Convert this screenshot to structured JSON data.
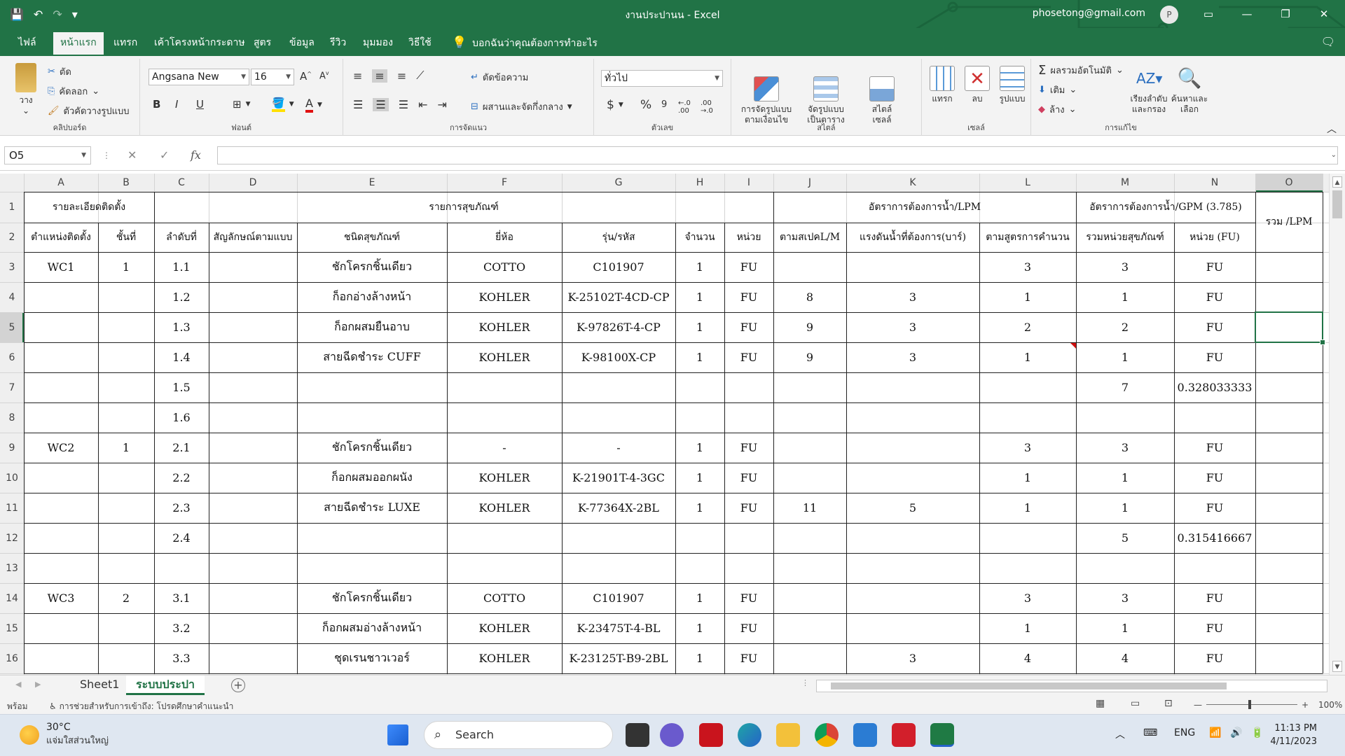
{
  "window": {
    "title": "งานประปานน  -  Excel",
    "account": "phosetong@gmail.com",
    "avatar_letter": "P"
  },
  "tabs": [
    {
      "label": "ไฟล์"
    },
    {
      "label": "หน้าแรก"
    },
    {
      "label": "แทรก"
    },
    {
      "label": "เค้าโครงหน้ากระดาษ"
    },
    {
      "label": "สูตร"
    },
    {
      "label": "ข้อมูล"
    },
    {
      "label": "รีวิว"
    },
    {
      "label": "มุมมอง"
    },
    {
      "label": "วิธีใช้"
    }
  ],
  "tell_me": "บอกฉันว่าคุณต้องการทำอะไร",
  "ribbon": {
    "clipboard": {
      "name": "คลิปบอร์ด",
      "paste": "วาง",
      "cut": "ตัด",
      "copy": "คัดลอก",
      "format_painter": "ตัวคัดวางรูปแบบ"
    },
    "font": {
      "name": "ฟอนต์",
      "family": "Angsana New",
      "size": "16",
      "bold": "B",
      "italic": "I",
      "underline": "U"
    },
    "alignment": {
      "name": "การจัดแนว",
      "wrap": "ตัดข้อความ",
      "merge": "ผสานและจัดกึ่งกลาง"
    },
    "number": {
      "name": "ตัวเลข",
      "format": "ทั่วไป",
      "currency": "$",
      "percent": "%"
    },
    "styles": {
      "name": "สไตล์",
      "conditional": "การจัดรูปแบบ\nตามเงื่อนไข",
      "as_table": "จัดรูปแบบ\nเป็นตาราง",
      "cell_styles": "สไตล์\nเซลล์"
    },
    "cells": {
      "name": "เซลล์",
      "insert": "แทรก",
      "delete": "ลบ",
      "format": "รูปแบบ"
    },
    "editing": {
      "name": "การแก้ไข",
      "autosum": "ผลรวมอัตโนมัติ",
      "fill": "เติม",
      "clear": "ล้าง",
      "sort": "เรียงลำดับ\nและกรอง",
      "find": "ค้นหาและ\nเลือก"
    }
  },
  "formula_bar": {
    "name_box": "O5",
    "fx": "fx",
    "value": ""
  },
  "grid": {
    "columns": [
      "A",
      "B",
      "C",
      "D",
      "E",
      "F",
      "G",
      "H",
      "I",
      "J",
      "K",
      "L",
      "M",
      "N",
      "O"
    ],
    "rows": [
      "1",
      "2",
      "3",
      "4",
      "5",
      "6",
      "7",
      "8",
      "9",
      "10",
      "11",
      "12",
      "13",
      "14",
      "15",
      "16"
    ],
    "headers_row1": {
      "install": "รายละเอียดติดตั้ง",
      "sanitary": "รายการสุขภัณฑ์",
      "lpm": "อัตราการต้องการน้ำ/LPM",
      "gpm": "อัตราการต้องการน้ำ/GPM (3.785)",
      "total": "รวม /LPM"
    },
    "headers_row2": [
      "ตำแหน่งติดตั้ง",
      "ชั้นที่",
      "ลำดับที่",
      "สัญลักษณ์ตามแบบ",
      "ชนิดสุขภัณฑ์",
      "ยี่ห้อ",
      "รุ่น/รหัส",
      "จำนวน",
      "หน่วย",
      "ตามสเปคL/M",
      "แรงดันน้ำที่ต้องการ(บาร์)",
      "ตามสูตรการคำนวน",
      "รวมหน่วยสุขภัณฑ์",
      "หน่วย (FU)"
    ],
    "data": [
      [
        "WC1",
        "1",
        "1.1",
        "",
        "ชักโครกชิ้นเดียว",
        "COTTO",
        "C101907",
        "1",
        "FU",
        "",
        "",
        "3",
        "3",
        "FU"
      ],
      [
        "",
        "",
        "1.2",
        "",
        "ก็อกอ่างล้างหน้า",
        "KOHLER",
        "K-25102T-4CD-CP",
        "1",
        "FU",
        "8",
        "3",
        "1",
        "1",
        "FU"
      ],
      [
        "",
        "",
        "1.3",
        "",
        "ก็อกผสมยืนอาบ",
        "KOHLER",
        "K-97826T-4-CP",
        "1",
        "FU",
        "9",
        "3",
        "2",
        "2",
        "FU"
      ],
      [
        "",
        "",
        "1.4",
        "",
        "สายฉีดชำระ CUFF",
        "KOHLER",
        "K-98100X-CP",
        "1",
        "FU",
        "9",
        "3",
        "1",
        "1",
        "FU"
      ],
      [
        "",
        "",
        "1.5",
        "",
        "",
        "",
        "",
        "",
        "",
        "",
        "",
        "",
        "7",
        "0.328033333"
      ],
      [
        "",
        "",
        "1.6",
        "",
        "",
        "",
        "",
        "",
        "",
        "",
        "",
        "",
        "",
        ""
      ],
      [
        "WC2",
        "1",
        "2.1",
        "",
        "ชักโครกชิ้นเดียว",
        "-",
        "-",
        "1",
        "FU",
        "",
        "",
        "3",
        "3",
        "FU"
      ],
      [
        "",
        "",
        "2.2",
        "",
        "ก็อกผสมออกผนัง",
        "KOHLER",
        "K-21901T-4-3GC",
        "1",
        "FU",
        "",
        "",
        "1",
        "1",
        "FU"
      ],
      [
        "",
        "",
        "2.3",
        "",
        "สายฉีดชำระ LUXE",
        "KOHLER",
        "K-77364X-2BL",
        "1",
        "FU",
        "11",
        "5",
        "1",
        "1",
        "FU"
      ],
      [
        "",
        "",
        "2.4",
        "",
        "",
        "",
        "",
        "",
        "",
        "",
        "",
        "",
        "5",
        "0.315416667"
      ],
      [
        "",
        "",
        "",
        "",
        "",
        "",
        "",
        "",
        "",
        "",
        "",
        "",
        "",
        ""
      ],
      [
        "WC3",
        "2",
        "3.1",
        "",
        "ชักโครกชิ้นเดียว",
        "COTTO",
        "C101907",
        "1",
        "FU",
        "",
        "",
        "3",
        "3",
        "FU"
      ],
      [
        "",
        "",
        "3.2",
        "",
        "ก็อกผสมอ่างล้างหน้า",
        "KOHLER",
        "K-23475T-4-BL",
        "1",
        "FU",
        "",
        "",
        "1",
        "1",
        "FU"
      ],
      [
        "",
        "",
        "3.3",
        "",
        "ชุดเรนชาวเวอร์",
        "KOHLER",
        "K-23125T-B9-2BL",
        "1",
        "FU",
        "",
        "3",
        "4",
        "4",
        "FU"
      ]
    ]
  },
  "sheets": [
    {
      "label": "Sheet1"
    },
    {
      "label": "ระบบประปา"
    }
  ],
  "status": {
    "ready": "พร้อม",
    "accessibility": "การช่วยสำหรับการเข้าถึง: โปรดศึกษาคำแนะนำ",
    "zoom": "100%"
  },
  "taskbar": {
    "temp": "30°C",
    "weather": "แจ่มใสส่วนใหญ่",
    "search": "Search",
    "lang": "ENG",
    "time": "11:13 PM",
    "date": "4/11/2023"
  },
  "colors": {
    "excel_green": "#217346",
    "ribbon_bg": "#f3f3f3",
    "grid_line": "#d4d4d4"
  }
}
